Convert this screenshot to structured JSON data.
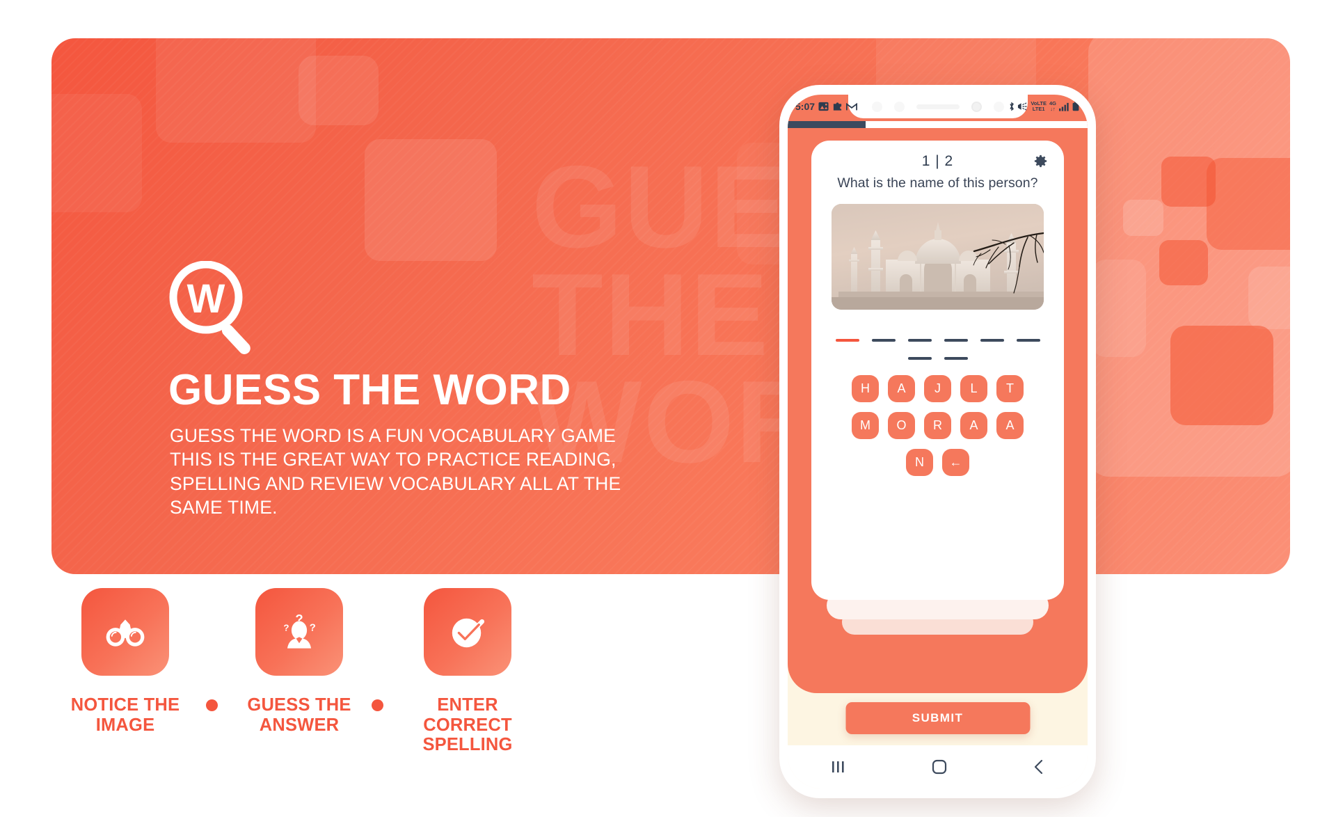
{
  "brand": {
    "title": "GUESS THE WORD",
    "description": "GUESS THE WORD IS A FUN VOCABULARY GAME THIS IS THE GREAT WAY TO PRACTICE READING, SPELLING AND REVIEW VOCABULARY ALL AT THE SAME TIME.",
    "watermark": "GUE\nTHE\nWOR",
    "logo_letter": "W",
    "accent": "#f4563e",
    "accent_light": "#f5785c",
    "panel_gradient_start": "#f4563e",
    "panel_gradient_end": "#fb9077"
  },
  "features": [
    {
      "icon": "binoculars-icon",
      "label": "NOTICE THE\nIMAGE"
    },
    {
      "icon": "thinking-person-icon",
      "label": "GUESS THE\nANSWER"
    },
    {
      "icon": "check-circle-icon",
      "label": "ENTER CORRECT\nSPELLING"
    }
  ],
  "phone": {
    "statusbar": {
      "time": "5:07",
      "left_icons": [
        "photo-icon",
        "puzzle-icon",
        "gmail-icon"
      ],
      "right_icons": [
        "bluetooth-icon",
        "vibrate-icon",
        "signal-icon",
        "battery-icon"
      ],
      "volte_label_top": "VoLTE",
      "volte_label_bottom": "LTE1",
      "network_label": "4G",
      "data_arrows": "↓↑"
    },
    "app": {
      "counter": "1 | 2",
      "settings_icon": "gear-icon",
      "question": "What is the name of this person?",
      "image_alt": "taj-mahal-photo",
      "answer_rows": [
        {
          "blanks": 6,
          "active_index": 0
        },
        {
          "blanks": 2,
          "active_index": -1
        }
      ],
      "letter_rows": [
        [
          "H",
          "A",
          "J",
          "L",
          "T"
        ],
        [
          "M",
          "O",
          "R",
          "A",
          "A"
        ],
        [
          "N",
          "←"
        ]
      ],
      "backspace_key": "←",
      "submit_label": "SUBMIT"
    },
    "navbar": {
      "recents_icon": "recents-icon",
      "home_icon": "home-icon",
      "back_icon": "back-icon"
    }
  }
}
